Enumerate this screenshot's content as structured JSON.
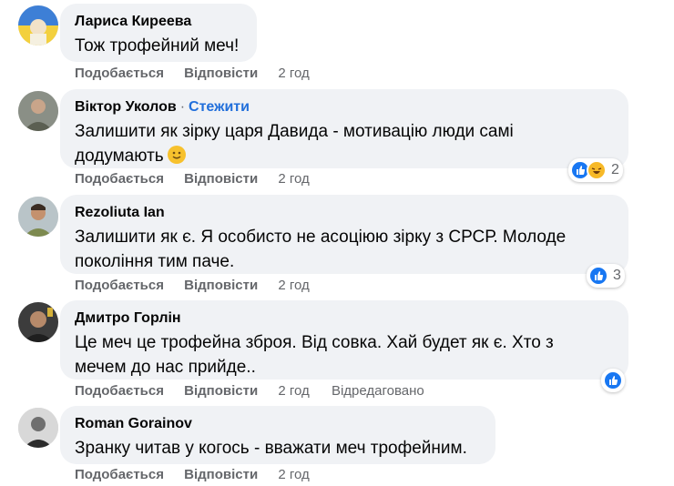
{
  "comments": [
    {
      "author": "Лариса Киреева",
      "follow": "",
      "lines": [
        "Тож трофейний меч!"
      ],
      "actions": {
        "like": "Подобається",
        "reply": "Відповісти",
        "time": "2 год",
        "edited": ""
      },
      "reactions": null
    },
    {
      "author": "Віктор Уколов",
      "follow": "Стежити",
      "lines": [
        "Залишити як зірку царя Давида - мотивацію люди самі",
        "додумають"
      ],
      "emoji": "slightly-smiling-face-emoji",
      "actions": {
        "like": "Подобається",
        "reply": "Відповісти",
        "time": "2 год",
        "edited": ""
      },
      "reactions": {
        "types": [
          "like-icon",
          "haha-icon"
        ],
        "count": "2"
      }
    },
    {
      "author": "Rezoliuta Ian",
      "follow": "",
      "lines": [
        "Залишити як є. Я особисто не асоціюю зірку з СРСР. Молоде",
        "покоління тим паче."
      ],
      "actions": {
        "like": "Подобається",
        "reply": "Відповісти",
        "time": "2 год",
        "edited": ""
      },
      "reactions": {
        "types": [
          "like-icon"
        ],
        "count": "3"
      }
    },
    {
      "author": "Дмитро Горлін",
      "follow": "",
      "lines": [
        "Це меч це трофейна зброя. Від совка. Хай будет як є. Хто з",
        "мечем до нас прийде.."
      ],
      "actions": {
        "like": "Подобається",
        "reply": "Відповісти",
        "time": "2 год",
        "edited": "Відредаговано"
      },
      "reactions": {
        "types": [
          "like-icon"
        ],
        "count": ""
      }
    },
    {
      "author": "Roman Gorainov",
      "follow": "",
      "lines": [
        "Зранку читав у когось - вважати меч трофейним."
      ],
      "actions": {
        "like": "Подобається",
        "reply": "Відповісти",
        "time": "2 год",
        "edited": ""
      },
      "reactions": null
    }
  ],
  "colors": {
    "bubble": "#f0f2f5",
    "link": "#216fdb",
    "meta": "#65676b",
    "like": "#1877f2",
    "haha": "#f7b928"
  }
}
